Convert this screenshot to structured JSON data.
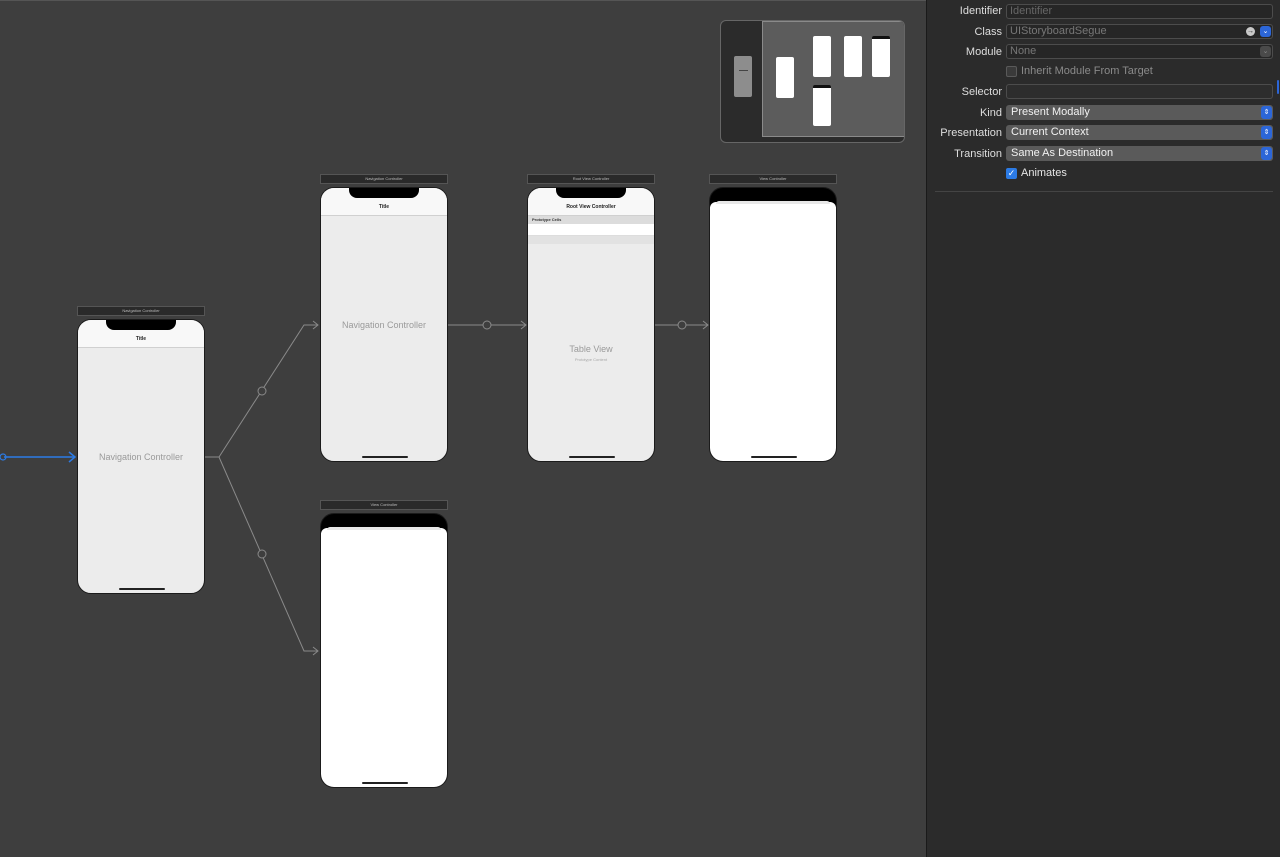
{
  "canvas": {
    "scenes": [
      {
        "id": "nav1",
        "type": "nav",
        "header": "Navigation Controller",
        "nav_title": "Title",
        "center_label": "Navigation Controller"
      },
      {
        "id": "nav2",
        "type": "nav",
        "header": "Navigation Controller",
        "nav_title": "Title",
        "center_label": "Navigation Controller"
      },
      {
        "id": "root",
        "type": "table",
        "header": "Root View Controller",
        "nav_title": "Root View Controller",
        "section_header": "Prototype Cells",
        "center_label": "Table View",
        "sub_label": "Prototype Content"
      },
      {
        "id": "vc1",
        "type": "white",
        "header": "View Controller"
      },
      {
        "id": "vc2",
        "type": "white",
        "header": "View Controller"
      }
    ],
    "colors": {
      "canvas": "#3e3e3e",
      "selected_segue": "#2c7be5",
      "segue": "#8a8a8a"
    }
  },
  "inspector": {
    "identifier": {
      "label": "Identifier",
      "value": "",
      "placeholder": "Identifier"
    },
    "class": {
      "label": "Class",
      "value": "UIStoryboardSegue"
    },
    "module": {
      "label": "Module",
      "value": "None"
    },
    "inherit": {
      "label": "Inherit Module From Target",
      "checked": false
    },
    "selector": {
      "label": "Selector",
      "value": ""
    },
    "kind": {
      "label": "Kind",
      "value": "Present Modally"
    },
    "presentation": {
      "label": "Presentation",
      "value": "Current Context"
    },
    "transition": {
      "label": "Transition",
      "value": "Same As Destination"
    },
    "animates": {
      "label": "Animates",
      "checked": true
    }
  }
}
